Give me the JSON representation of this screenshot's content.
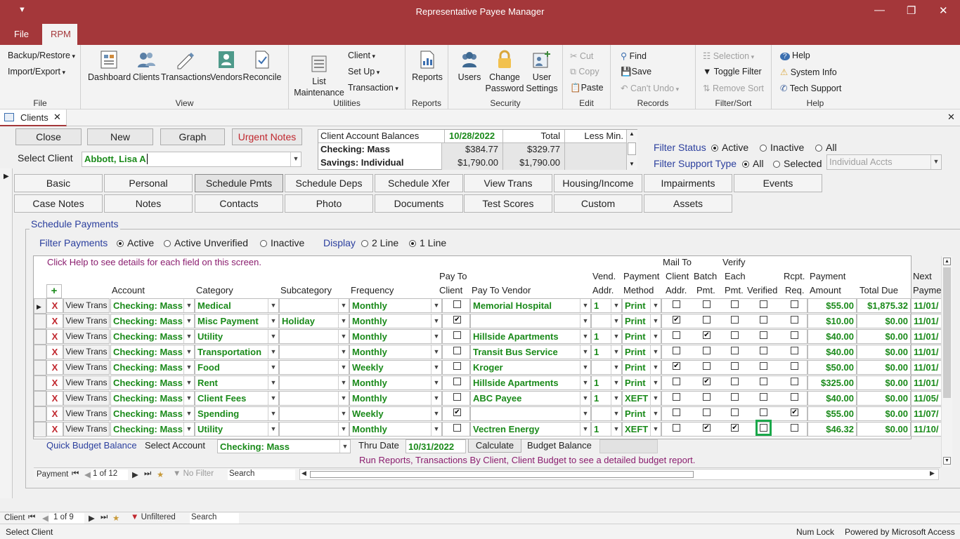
{
  "window": {
    "title": "Representative Payee Manager"
  },
  "ribbon_tabs": [
    "File",
    "RPM"
  ],
  "ribbon": {
    "file_group": {
      "backup": "Backup/Restore",
      "import": "Import/Export",
      "label": "File"
    },
    "view_group": {
      "dashboard": "Dashboard",
      "clients": "Clients",
      "transactions": "Transactions",
      "vendors": "Vendors",
      "reconcile": "Reconcile",
      "label": "View"
    },
    "utilities_group": {
      "list1": "List",
      "list2": "Maintenance",
      "client": "Client",
      "setup": "Set Up",
      "transaction": "Transaction",
      "label": "Utilities"
    },
    "reports_group": {
      "reports": "Reports",
      "label": "Reports"
    },
    "security_group": {
      "users": "Users",
      "change1": "Change",
      "change2": "Password",
      "user1": "User",
      "user2": "Settings",
      "label": "Security"
    },
    "edit_group": {
      "cut": "Cut",
      "copy": "Copy",
      "paste": "Paste",
      "label": "Edit"
    },
    "records_group": {
      "find": "Find",
      "save": "Save",
      "undo": "Can't Undo",
      "label": "Records"
    },
    "filter_group": {
      "selection": "Selection",
      "toggle": "Toggle Filter",
      "remove": "Remove Sort",
      "label": "Filter/Sort"
    },
    "help_group": {
      "help": "Help",
      "sysinfo": "System Info",
      "tech": "Tech Support",
      "label": "Help"
    }
  },
  "doc_tab": {
    "label": "Clients"
  },
  "top_buttons": {
    "close": "Close",
    "new": "New",
    "graph": "Graph",
    "urgent": "Urgent Notes"
  },
  "select_client": {
    "label": "Select Client",
    "value": "Abbott, Lisa A"
  },
  "balances": {
    "header": "Client Account Balances",
    "date": "10/28/2022",
    "total": "Total",
    "less_min": "Less Min.",
    "rows": [
      {
        "name": "Checking: Mass",
        "bal": "$384.77",
        "total": "$329.77"
      },
      {
        "name": "Savings: Individual",
        "bal": "$1,790.00",
        "total": "$1,790.00"
      }
    ]
  },
  "filter_status": {
    "label": "Filter Status",
    "options": [
      "Active",
      "Inactive",
      "All"
    ]
  },
  "filter_support": {
    "label": "Filter Support Type",
    "options": [
      "All",
      "Selected"
    ],
    "select_value": "Individual Accts"
  },
  "tabs_row1": [
    "Basic",
    "Personal",
    "Schedule Pmts",
    "Schedule Deps",
    "Schedule Xfer",
    "View Trans",
    "Housing/Income",
    "Impairments",
    "Events"
  ],
  "tabs_row2": [
    "Case Notes",
    "Notes",
    "Contacts",
    "Photo",
    "Documents",
    "Test Scores",
    "Custom",
    "Assets"
  ],
  "schedule": {
    "title": "Schedule Payments",
    "filter_label": "Filter Payments",
    "filter_opts": [
      "Active",
      "Active Unverified",
      "Inactive"
    ],
    "display_label": "Display",
    "display_opts": [
      "2 Line",
      "1 Line"
    ],
    "help_text": "Click Help to see details for each field on this screen.",
    "headers": {
      "account": "Account",
      "category": "Category",
      "subcategory": "Subcategory",
      "frequency": "Frequency",
      "payto1": "Pay To",
      "payto2": "Client",
      "vendor": "Pay To Vendor",
      "vend1": "Vend.",
      "vend2": "Addr.",
      "pm1": "Payment",
      "pm2": "Method",
      "mail1": "Mail To",
      "mail2": "Client",
      "mail3": "Addr.",
      "batch1": "Batch",
      "batch2": "Pmt.",
      "verify1": "Verify",
      "verify2": "Each",
      "verify3": "Pmt.",
      "verified": "Verified",
      "rcpt1": "Rcpt.",
      "rcpt2": "Req.",
      "amt1": "Payment",
      "amt2": "Amount",
      "due": "Total Due",
      "next1": "Next",
      "next2": "Payme"
    },
    "add_symbol": "+",
    "rows": [
      {
        "del": "X",
        "vt": "View Trans",
        "account": "Checking: Mass",
        "category": "Medical",
        "sub": "",
        "freq": "Monthly",
        "payto": false,
        "vendor": "Memorial Hospital",
        "addr": "1",
        "method": "Print",
        "mail": false,
        "batch": false,
        "verify": false,
        "verified": false,
        "rcpt": false,
        "amount": "$55.00",
        "due": "$1,875.32",
        "next": "11/01/"
      },
      {
        "del": "X",
        "vt": "View Trans",
        "account": "Checking: Mass",
        "category": "Misc Payment",
        "sub": "Holiday",
        "freq": "Monthly",
        "payto": true,
        "vendor": "",
        "addr": "",
        "method": "Print",
        "mail": true,
        "batch": false,
        "verify": false,
        "verified": false,
        "rcpt": false,
        "amount": "$10.00",
        "due": "$0.00",
        "next": "11/01/"
      },
      {
        "del": "X",
        "vt": "View Trans",
        "account": "Checking: Mass",
        "category": "Utility",
        "sub": "",
        "freq": "Monthly",
        "payto": false,
        "vendor": "Hillside Apartments",
        "addr": "1",
        "method": "Print",
        "mail": false,
        "batch": true,
        "verify": false,
        "verified": false,
        "rcpt": false,
        "amount": "$40.00",
        "due": "$0.00",
        "next": "11/01/"
      },
      {
        "del": "X",
        "vt": "View Trans",
        "account": "Checking: Mass",
        "category": "Transportation",
        "sub": "",
        "freq": "Monthly",
        "payto": false,
        "vendor": "Transit Bus Service",
        "addr": "1",
        "method": "Print",
        "mail": false,
        "batch": false,
        "verify": false,
        "verified": false,
        "rcpt": false,
        "amount": "$40.00",
        "due": "$0.00",
        "next": "11/01/"
      },
      {
        "del": "X",
        "vt": "View Trans",
        "account": "Checking: Mass",
        "category": "Food",
        "sub": "",
        "freq": "Weekly",
        "payto": false,
        "vendor": "Kroger",
        "addr": "",
        "method": "Print",
        "mail": true,
        "batch": false,
        "verify": false,
        "verified": false,
        "rcpt": false,
        "amount": "$50.00",
        "due": "$0.00",
        "next": "11/01/"
      },
      {
        "del": "X",
        "vt": "View Trans",
        "account": "Checking: Mass",
        "category": "Rent",
        "sub": "",
        "freq": "Monthly",
        "payto": false,
        "vendor": "Hillside Apartments",
        "addr": "1",
        "method": "Print",
        "mail": false,
        "batch": true,
        "verify": false,
        "verified": false,
        "rcpt": false,
        "amount": "$325.00",
        "due": "$0.00",
        "next": "11/01/"
      },
      {
        "del": "X",
        "vt": "View Trans",
        "account": "Checking: Mass",
        "category": "Client Fees",
        "sub": "",
        "freq": "Monthly",
        "payto": false,
        "vendor": "ABC Payee",
        "addr": "1",
        "method": "XEFT",
        "mail": false,
        "batch": false,
        "verify": false,
        "verified": false,
        "rcpt": false,
        "amount": "$40.00",
        "due": "$0.00",
        "next": "11/05/"
      },
      {
        "del": "X",
        "vt": "View Trans",
        "account": "Checking: Mass",
        "category": "Spending",
        "sub": "",
        "freq": "Weekly",
        "payto": true,
        "vendor": "",
        "addr": "",
        "method": "Print",
        "mail": false,
        "batch": false,
        "verify": false,
        "verified": false,
        "rcpt": true,
        "amount": "$55.00",
        "due": "$0.00",
        "next": "11/07/"
      },
      {
        "del": "X",
        "vt": "View Trans",
        "account": "Checking: Mass",
        "category": "Utility",
        "sub": "",
        "freq": "Monthly",
        "payto": false,
        "vendor": "Vectren Energy",
        "addr": "1",
        "method": "XEFT",
        "mail": false,
        "batch": true,
        "verify": true,
        "verified": false,
        "rcpt": false,
        "amount": "$46.32",
        "due": "$0.00",
        "next": "11/10/"
      }
    ],
    "budget": {
      "label": "Quick Budget Balance",
      "select_label": "Select Account",
      "account": "Checking: Mass",
      "thru_label": "Thru Date",
      "thru": "10/31/2022",
      "calc": "Calculate",
      "balance_label": "Budget Balance",
      "note": "Run Reports, Transactions By Client, Client Budget to see a detailed budget report."
    },
    "nav": {
      "label": "Payment",
      "pos": "1 of 12",
      "filter": "No Filter",
      "search": "Search"
    }
  },
  "client_nav": {
    "label": "Client",
    "pos": "1 of 9",
    "filter": "Unfiltered",
    "search": "Search"
  },
  "status": {
    "left": "Select Client",
    "numlock": "Num Lock",
    "powered": "Powered by Microsoft Access"
  },
  "colors": {
    "brand": "#a4373a",
    "green_text": "#1a8a1a",
    "urgent": "#c0262d",
    "label_blue": "#2b3f9e"
  }
}
